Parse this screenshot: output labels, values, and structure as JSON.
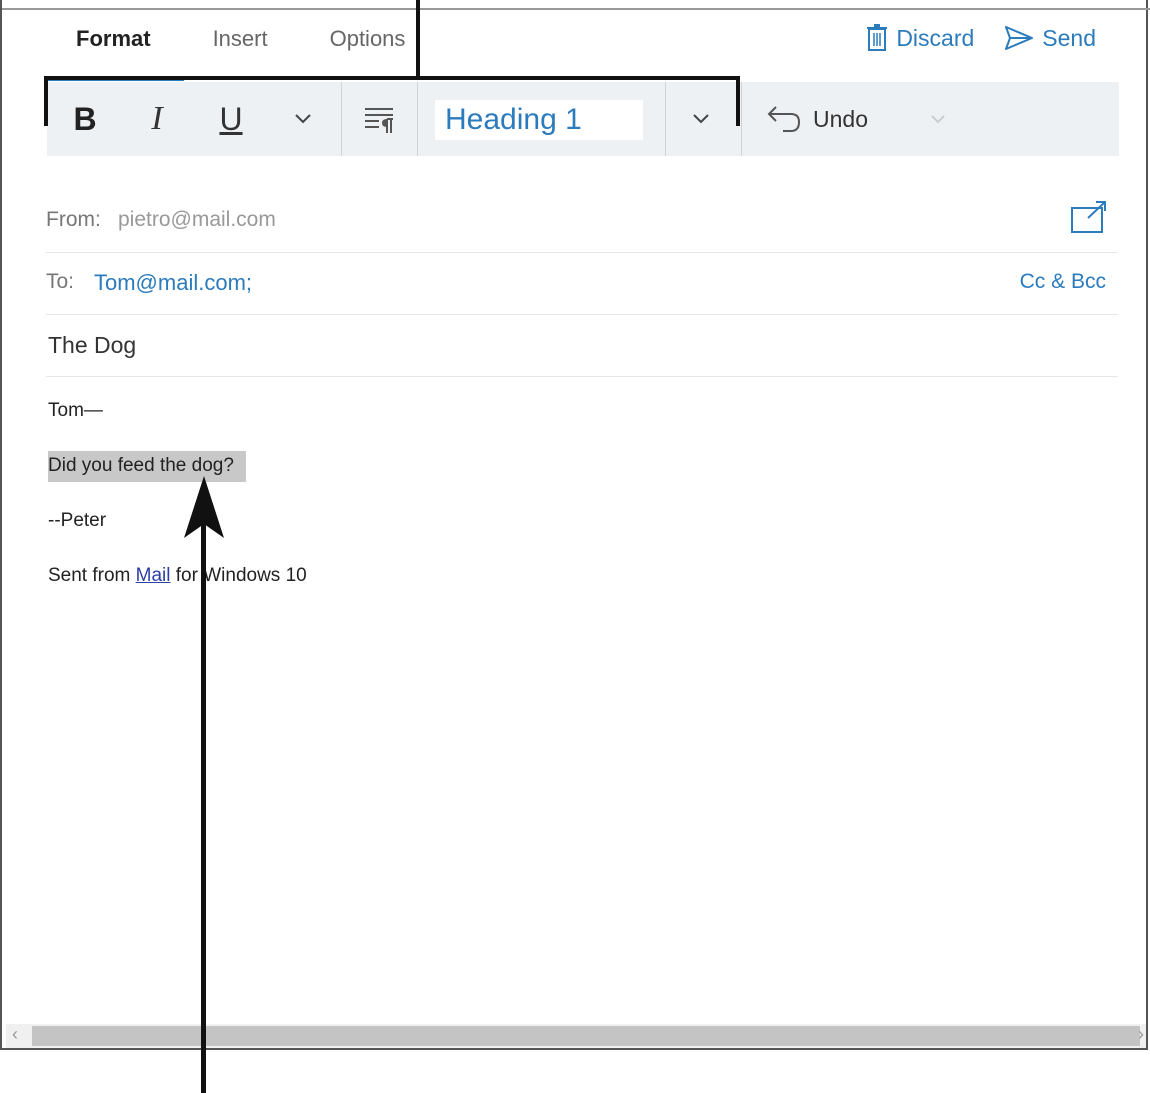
{
  "tabs": [
    {
      "label": "Format",
      "active": true
    },
    {
      "label": "Insert",
      "active": false
    },
    {
      "label": "Options",
      "active": false
    }
  ],
  "actions": {
    "discard_label": "Discard",
    "send_label": "Send",
    "discard_icon": "trash-icon",
    "send_icon": "send-icon"
  },
  "toolbar": {
    "bold_label": "B",
    "italic_label": "I",
    "underline_label": "U",
    "style_value": "Heading 1",
    "undo_label": "Undo"
  },
  "header": {
    "from_label": "From:",
    "from_value": "pietro@mail.com",
    "to_label": "To:",
    "to_value": "Tom@mail.com;",
    "cc_bcc_label": "Cc & Bcc",
    "subject": "The Dog"
  },
  "body": {
    "greeting": "Tom—",
    "question": "Did you feed the dog?",
    "signoff": "--Peter",
    "sent_prefix": "Sent from ",
    "sent_link": "Mail",
    "sent_suffix": " for Windows 10"
  },
  "colors": {
    "accent": "#2b7bbd",
    "link": "#2c3fa6",
    "highlight": "#c8c8c8",
    "toolbar_bg": "#eef1f4"
  }
}
